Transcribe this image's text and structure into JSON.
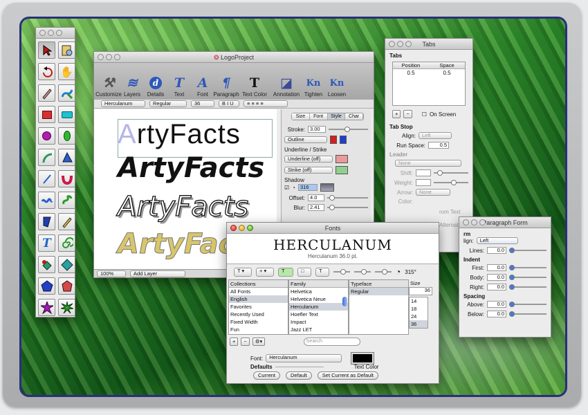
{
  "main_window": {
    "title": "LogoProject",
    "toolbar": [
      "Customize",
      "Layers",
      "Details",
      "Text",
      "Font",
      "Paragraph",
      "Text Color",
      "Annotation",
      "Tighten",
      "Loosen"
    ],
    "font_family": "Herculanum",
    "font_style": "Regular",
    "font_size": "36",
    "artwork_text": "ArtyFacts",
    "zoom": "100%",
    "add_layer": "Add Layer"
  },
  "inspector": {
    "tabs": [
      "Size",
      "Font",
      "Style",
      "Char"
    ],
    "stroke_label": "Stroke:",
    "stroke_value": "3.00",
    "outline": "Outline",
    "underline_strike_label": "Underline / Strike",
    "underline": "Underline (off)",
    "strike": "Strike (off)",
    "shadow_label": "Shadow",
    "shadow_angle": "316",
    "offset_label": "Offset:",
    "offset_value": "4.0",
    "blur_label": "Blur:",
    "blur_value": "2.41",
    "colors": {
      "stroke_red": "#d42020",
      "stroke_blue": "#1f3fd0",
      "underline": "#e89b9b",
      "strike": "#8fd08f"
    }
  },
  "tabs_window": {
    "title": "Tabs",
    "section": "Tabs",
    "col_position": "Position",
    "col_space": "Space",
    "row_position": "0.5",
    "row_space": "0.5",
    "on_screen": "On Screen",
    "tab_stop": "Tab Stop",
    "align_label": "Align:",
    "align_value": "Left",
    "run_space_label": "Run Space:",
    "run_space_value": "0.5",
    "leader": "Leader",
    "leader_value": "None",
    "shift_label": "Shift:",
    "weight_label": "Weight:",
    "arrow_label": "Arrow:",
    "arrow_value": "None",
    "color_label": "Color:",
    "from_text": "rom Text",
    "alternate": "Alternate"
  },
  "paragraph_window": {
    "title": "Paragraph Form",
    "form_label": "rm",
    "align_label": "lign:",
    "align_value": "Left",
    "lines_label": "Lines:",
    "lines_value": "0.0",
    "indent": "Indent",
    "first_label": "First:",
    "first_value": "0.0",
    "body_label": "Body:",
    "body_value": "0.0",
    "right_label": "Right:",
    "right_value": "0.0",
    "spacing": "Spacing",
    "above_label": "Above:",
    "above_value": "0.0",
    "below_label": "Below:",
    "below_value": "0.0"
  },
  "fonts_panel": {
    "title": "Fonts",
    "preview": "HERCULANUM",
    "preview_sub": "Herculanum 36.0 pt.",
    "angle": "315°",
    "collections_header": "Collections",
    "collections": [
      "All Fonts",
      "English",
      "Favorites",
      "Recently Used",
      "Fixed Width",
      "Fun"
    ],
    "family_header": "Family",
    "families": [
      "Helvetica",
      "Helvetica Neue",
      "Herculanum",
      "Hoefler Text",
      "Impact",
      "Jazz LET"
    ],
    "typeface_header": "Typeface",
    "typefaces": [
      "Regular"
    ],
    "size_header": "Size",
    "size_value": "36",
    "sizes": [
      "14",
      "18",
      "24",
      "36"
    ],
    "search_placeholder": "Search",
    "font_label": "Font:",
    "font_value": "Herculanum",
    "defaults": "Defaults",
    "text_color": "Text Color",
    "btn_current": "Current",
    "btn_default": "Default",
    "btn_set_current": "Set Current as Default"
  }
}
